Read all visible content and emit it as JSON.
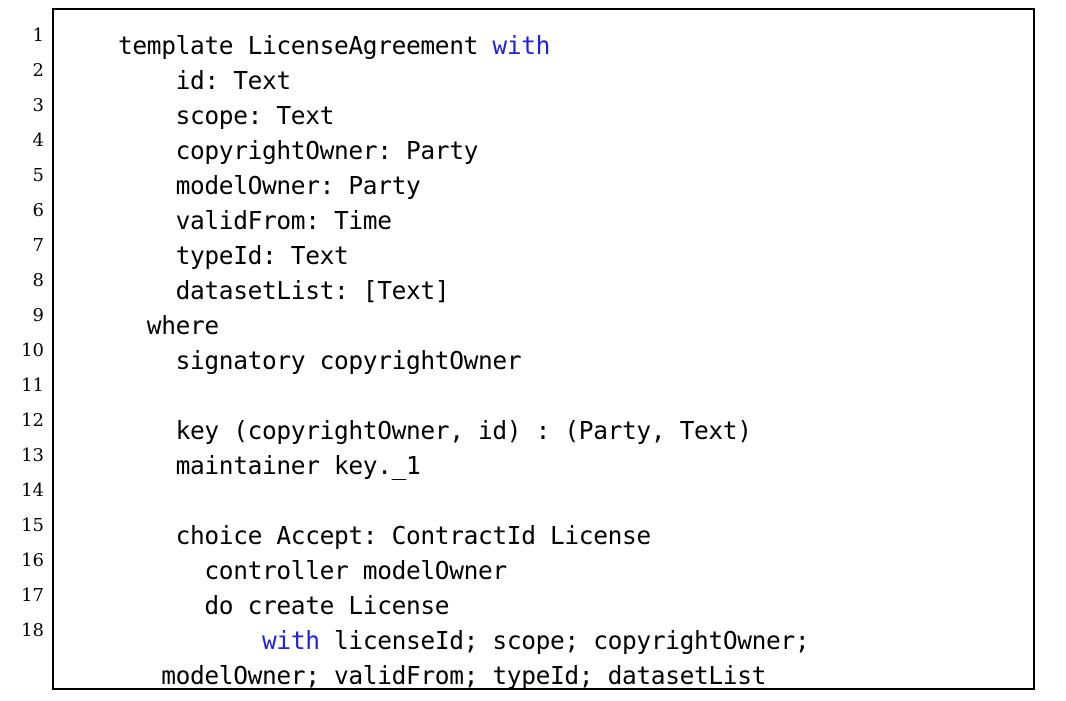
{
  "listing": {
    "language": "daml",
    "keyword_color": "#2222dd",
    "text_color": "#000000",
    "background_color": "#ffffff",
    "border_color": "#000000",
    "line_numbers": [
      "1",
      "2",
      "3",
      "4",
      "5",
      "6",
      "7",
      "8",
      "9",
      "10",
      "11",
      "12",
      "13",
      "14",
      "15",
      "16",
      "17",
      "18",
      ""
    ],
    "lines": [
      {
        "number": "1",
        "segments": [
          {
            "text": "template LicenseAgreement ",
            "kind": "plain"
          },
          {
            "text": "with",
            "kind": "keyword"
          }
        ]
      },
      {
        "number": "2",
        "segments": [
          {
            "text": "    id: Text",
            "kind": "plain"
          }
        ]
      },
      {
        "number": "3",
        "segments": [
          {
            "text": "    scope: Text",
            "kind": "plain"
          }
        ]
      },
      {
        "number": "4",
        "segments": [
          {
            "text": "    copyrightOwner: Party",
            "kind": "plain"
          }
        ]
      },
      {
        "number": "5",
        "segments": [
          {
            "text": "    modelOwner: Party",
            "kind": "plain"
          }
        ]
      },
      {
        "number": "6",
        "segments": [
          {
            "text": "    validFrom: Time",
            "kind": "plain"
          }
        ]
      },
      {
        "number": "7",
        "segments": [
          {
            "text": "    typeId: Text",
            "kind": "plain"
          }
        ]
      },
      {
        "number": "8",
        "segments": [
          {
            "text": "    datasetList: [Text]",
            "kind": "plain"
          }
        ]
      },
      {
        "number": "9",
        "segments": [
          {
            "text": "  where",
            "kind": "plain"
          }
        ]
      },
      {
        "number": "10",
        "segments": [
          {
            "text": "    signatory copyrightOwner",
            "kind": "plain"
          }
        ]
      },
      {
        "number": "11",
        "segments": [
          {
            "text": "",
            "kind": "plain"
          }
        ]
      },
      {
        "number": "12",
        "segments": [
          {
            "text": "    key (copyrightOwner, id) : (Party, Text)",
            "kind": "plain"
          }
        ]
      },
      {
        "number": "13",
        "segments": [
          {
            "text": "    maintainer key._1",
            "kind": "plain"
          }
        ]
      },
      {
        "number": "14",
        "segments": [
          {
            "text": "",
            "kind": "plain"
          }
        ]
      },
      {
        "number": "15",
        "segments": [
          {
            "text": "    choice Accept: ContractId License",
            "kind": "plain"
          }
        ]
      },
      {
        "number": "16",
        "segments": [
          {
            "text": "      controller modelOwner",
            "kind": "plain"
          }
        ]
      },
      {
        "number": "17",
        "segments": [
          {
            "text": "      do create License",
            "kind": "plain"
          }
        ]
      },
      {
        "number": "18",
        "segments": [
          {
            "text": "          ",
            "kind": "plain"
          },
          {
            "text": "with",
            "kind": "keyword"
          },
          {
            "text": " licenseId; scope; copyrightOwner;",
            "kind": "plain"
          }
        ]
      },
      {
        "number": "",
        "continuation": true,
        "segments": [
          {
            "text": "   modelOwner; validFrom; typeId; datasetList",
            "kind": "plain"
          }
        ]
      }
    ]
  }
}
